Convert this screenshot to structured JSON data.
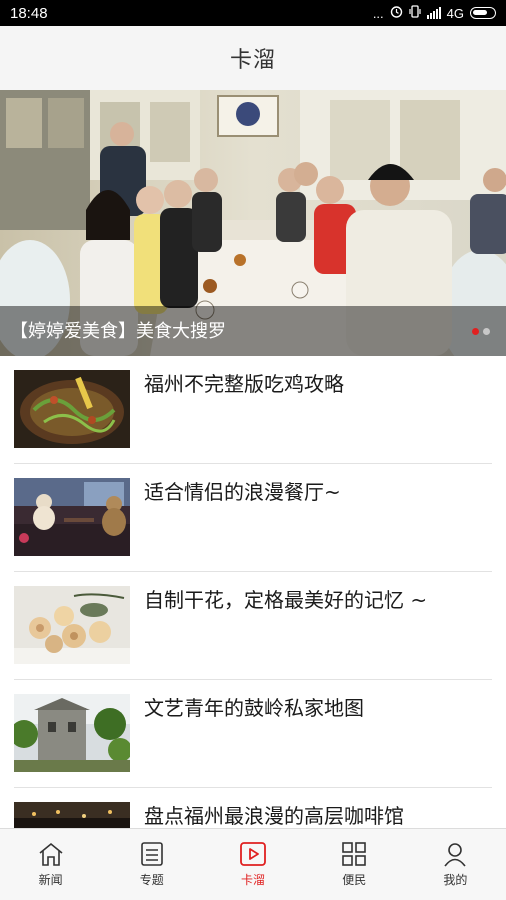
{
  "status_bar": {
    "time": "18:48",
    "dots": "...",
    "network": "4G",
    "icons": [
      "alarm-icon",
      "signal-icon",
      "battery-icon"
    ]
  },
  "header": {
    "title": "卡溜"
  },
  "banner": {
    "caption": "【婷婷爱美食】美食大搜罗",
    "page_count": 2,
    "active_index": 0
  },
  "articles": [
    {
      "title": "福州不完整版吃鸡攻略",
      "thumb": "food-dish-thumb"
    },
    {
      "title": "适合情侣的浪漫餐厅~",
      "thumb": "teddy-bear-restaurant-thumb"
    },
    {
      "title": "自制干花，定格最美好的记忆 ~",
      "thumb": "dried-roses-thumb"
    },
    {
      "title": "文艺青年的鼓岭私家地图",
      "thumb": "stone-house-thumb"
    },
    {
      "title": "盘点福州最浪漫的高层咖啡馆",
      "thumb": "night-city-thumb"
    }
  ],
  "tabs": [
    {
      "label": "新闻",
      "icon": "home-icon",
      "active": false
    },
    {
      "label": "专题",
      "icon": "document-icon",
      "active": false
    },
    {
      "label": "卡溜",
      "icon": "play-icon",
      "active": true
    },
    {
      "label": "便民",
      "icon": "grid-icon",
      "active": false
    },
    {
      "label": "我的",
      "icon": "person-icon",
      "active": false
    }
  ],
  "colors": {
    "accent": "#e02020",
    "status_bar_bg": "#000000",
    "nav_bg": "#f5f5f5"
  }
}
